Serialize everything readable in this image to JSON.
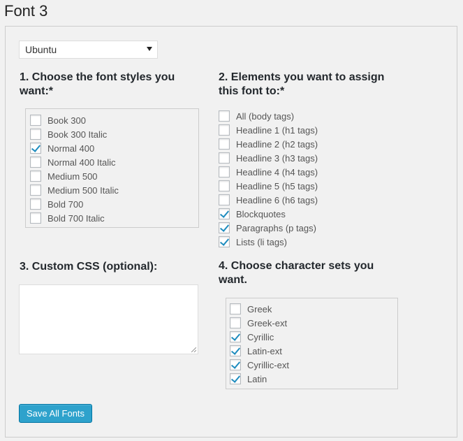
{
  "title": "Font 3",
  "font_select": {
    "value": "Ubuntu"
  },
  "section1": {
    "heading": "1. Choose the font styles you want:*",
    "items": [
      {
        "label": "Book 300",
        "checked": false
      },
      {
        "label": "Book 300 Italic",
        "checked": false
      },
      {
        "label": "Normal 400",
        "checked": true
      },
      {
        "label": "Normal 400 Italic",
        "checked": false
      },
      {
        "label": "Medium 500",
        "checked": false
      },
      {
        "label": "Medium 500 Italic",
        "checked": false
      },
      {
        "label": "Bold 700",
        "checked": false
      },
      {
        "label": "Bold 700 Italic",
        "checked": false
      }
    ]
  },
  "section2": {
    "heading": "2. Elements you want to assign this font to:*",
    "items": [
      {
        "label": "All (body tags)",
        "checked": false
      },
      {
        "label": "Headline 1 (h1 tags)",
        "checked": false
      },
      {
        "label": "Headline 2 (h2 tags)",
        "checked": false
      },
      {
        "label": "Headline 3 (h3 tags)",
        "checked": false
      },
      {
        "label": "Headline 4 (h4 tags)",
        "checked": false
      },
      {
        "label": "Headline 5 (h5 tags)",
        "checked": false
      },
      {
        "label": "Headline 6 (h6 tags)",
        "checked": false
      },
      {
        "label": "Blockquotes",
        "checked": true
      },
      {
        "label": "Paragraphs (p tags)",
        "checked": true
      },
      {
        "label": "Lists (li tags)",
        "checked": true
      }
    ]
  },
  "section3": {
    "heading": "3. Custom CSS (optional):",
    "value": ""
  },
  "section4": {
    "heading": "4. Choose character sets you want.",
    "items": [
      {
        "label": "Greek",
        "checked": false
      },
      {
        "label": "Greek-ext",
        "checked": false
      },
      {
        "label": "Cyrillic",
        "checked": true
      },
      {
        "label": "Latin-ext",
        "checked": true
      },
      {
        "label": "Cyrillic-ext",
        "checked": true
      },
      {
        "label": "Latin",
        "checked": true
      }
    ]
  },
  "save_button": {
    "label": "Save All Fonts"
  },
  "colors": {
    "accent": "#2ea2cc",
    "check": "#1e8cbe"
  }
}
